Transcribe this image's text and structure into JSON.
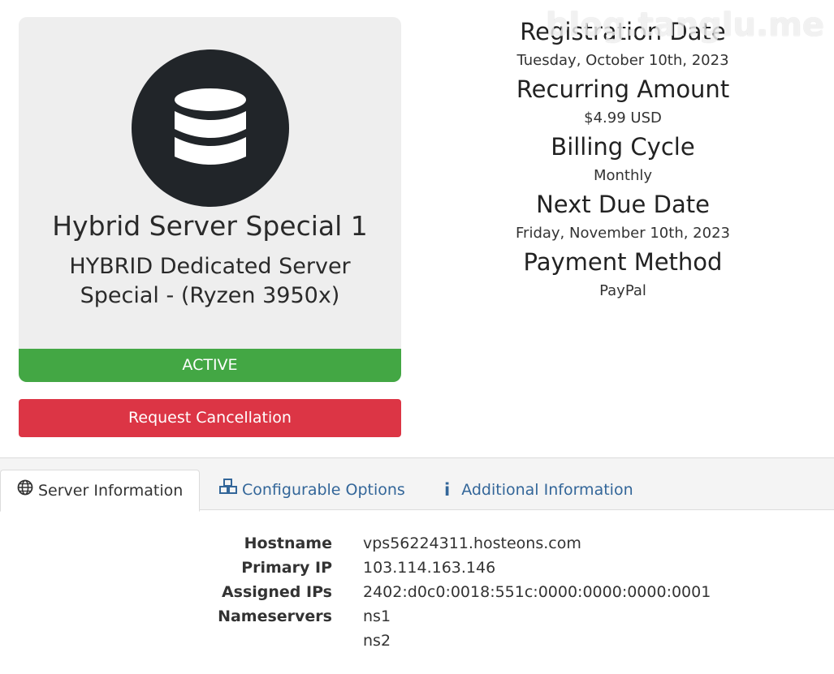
{
  "product": {
    "name": "Hybrid Server Special 1",
    "description": "HYBRID Dedicated Server Special - (Ryzen 3950x)",
    "icon": "database-icon",
    "status": "ACTIVE",
    "cancel_label": "Request Cancellation"
  },
  "billing": {
    "registration_date_label": "Registration Date",
    "registration_date": "Tuesday, October 10th, 2023",
    "recurring_amount_label": "Recurring Amount",
    "recurring_amount": "$4.99 USD",
    "billing_cycle_label": "Billing Cycle",
    "billing_cycle": "Monthly",
    "next_due_date_label": "Next Due Date",
    "next_due_date": "Friday, November 10th, 2023",
    "payment_method_label": "Payment Method",
    "payment_method": "PayPal"
  },
  "watermark": "blog.tanglu.me",
  "tabs": [
    {
      "label": "Server Information",
      "icon": "globe-icon",
      "active": true
    },
    {
      "label": "Configurable Options",
      "icon": "cubes-icon",
      "active": false
    },
    {
      "label": "Additional Information",
      "icon": "info-icon",
      "active": false
    }
  ],
  "server_info": {
    "hostname_label": "Hostname",
    "hostname": "vps56224311.hosteons.com",
    "primary_ip_label": "Primary IP",
    "primary_ip": "103.114.163.146",
    "assigned_ips_label": "Assigned IPs",
    "assigned_ips": "2402:d0c0:0018:551c:0000:0000:0000:0001",
    "nameservers_label": "Nameservers",
    "nameservers": [
      "ns1",
      "ns2"
    ]
  },
  "colors": {
    "active_green": "#43a744",
    "cancel_red": "#dc3545",
    "icon_circle": "#212529",
    "link_blue": "#336699"
  }
}
